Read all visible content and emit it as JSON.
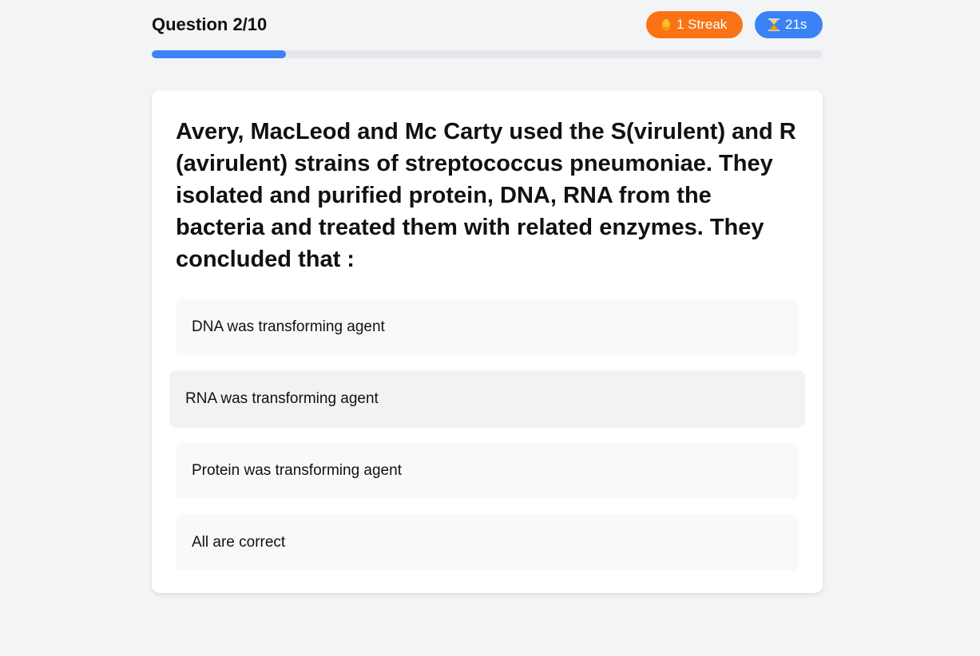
{
  "header": {
    "question_counter": "Question 2/10",
    "streak_label": "1 Streak",
    "timer_label": "21s",
    "streak_icon": "flame-icon",
    "timer_icon": "hourglass-icon",
    "streak_color": "#f97316",
    "timer_color": "#3b82f6"
  },
  "progress": {
    "current": 2,
    "total": 10,
    "fraction": 0.2,
    "fill_color": "#3b82f6"
  },
  "question": {
    "text": "Avery, MacLeod and Mc Carty used the S(virulent) and R (avirulent) strains of streptococcus pneumoniae. They isolated and purified protein, DNA, RNA from the bacteria and treated them with related enzymes. They concluded that :"
  },
  "options": [
    {
      "label": "DNA was transforming agent"
    },
    {
      "label": "RNA was transforming agent"
    },
    {
      "label": "Protein was transforming agent"
    },
    {
      "label": "All are correct"
    }
  ]
}
